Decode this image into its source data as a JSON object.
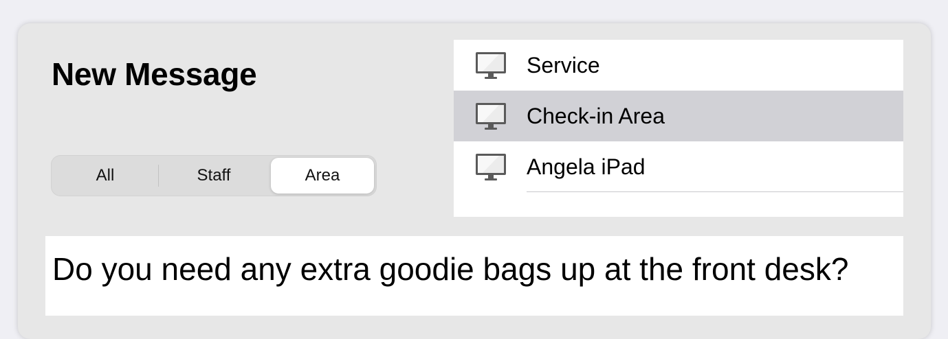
{
  "header": {
    "title": "New Message"
  },
  "filter": {
    "segments": [
      {
        "label": "All",
        "selected": false
      },
      {
        "label": "Staff",
        "selected": false
      },
      {
        "label": "Area",
        "selected": true
      }
    ]
  },
  "recipients": {
    "icon": "desktop-monitor-icon",
    "items": [
      {
        "label": "Service",
        "selected": false
      },
      {
        "label": "Check-in Area",
        "selected": true
      },
      {
        "label": "Angela iPad",
        "selected": false
      }
    ]
  },
  "message": {
    "text": "Do you need any extra goodie bags up at the front desk?"
  },
  "colors": {
    "background": "#efeff4",
    "panel": "#e7e7e7",
    "selected_row": "#d1d1d6",
    "icon_frame": "#5a5a5a"
  }
}
